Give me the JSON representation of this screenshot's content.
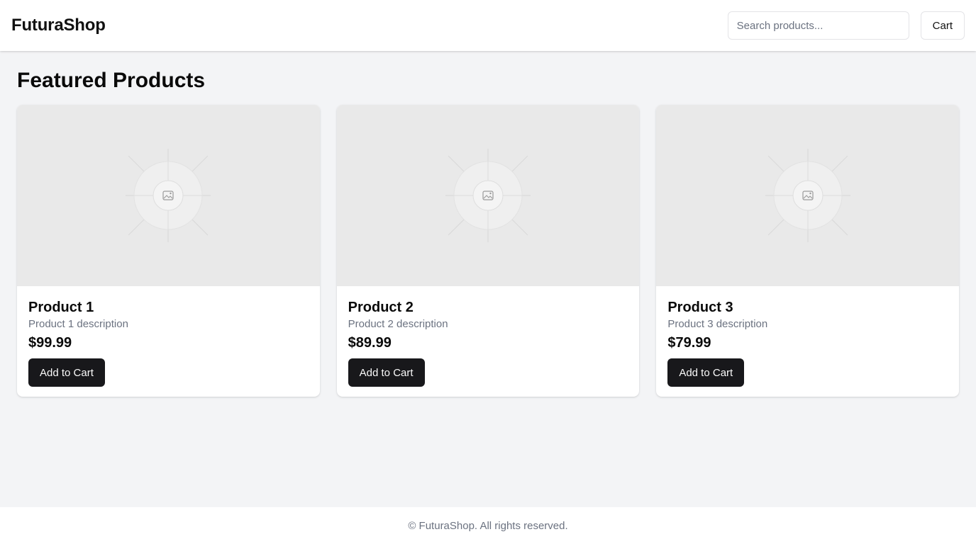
{
  "header": {
    "logo": "FuturaShop",
    "search_placeholder": "Search products...",
    "cart_label": "Cart"
  },
  "main": {
    "title": "Featured Products",
    "products": [
      {
        "name": "Product 1",
        "description": "Product 1 description",
        "price": "$99.99",
        "button_label": "Add to Cart",
        "image_icon": "image-placeholder-icon"
      },
      {
        "name": "Product 2",
        "description": "Product 2 description",
        "price": "$89.99",
        "button_label": "Add to Cart",
        "image_icon": "image-placeholder-icon"
      },
      {
        "name": "Product 3",
        "description": "Product 3 description",
        "price": "$79.99",
        "button_label": "Add to Cart",
        "image_icon": "image-placeholder-icon"
      }
    ]
  },
  "footer": {
    "text": "© FuturaShop. All rights reserved."
  },
  "colors": {
    "background": "#f3f4f6",
    "primary_button": "#18181b",
    "muted_text": "#6b7280",
    "image_placeholder": "#e9e9e9"
  }
}
